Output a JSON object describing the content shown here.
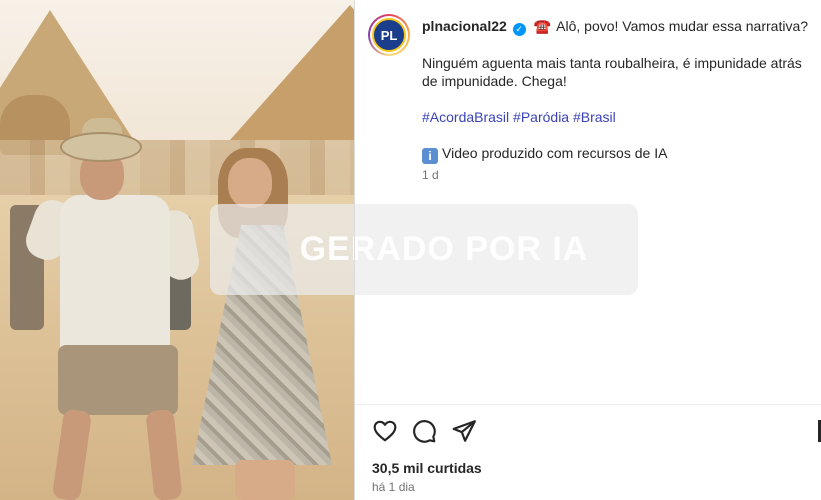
{
  "post": {
    "username": "plnacional22",
    "avatar_text": "PL",
    "headline": "Alô, povo! Vamos mudar essa narrativa?",
    "paragraph": "Ninguém aguenta mais tanta roubalheira, é impunidade atrás de impunidade. Chega!",
    "hashtags": [
      "#AcordaBrasil",
      "#Paródia",
      "#Brasil"
    ],
    "disclaimer": "Video produzido com recursos de IA",
    "timestamp_short": "1 d",
    "likes": "30,5 mil curtidas",
    "date": "há 1 dia"
  },
  "media": {
    "watermark": "GERADO POR IA"
  },
  "icons": {
    "verified": "verified-badge-icon",
    "phone": "telephone-icon",
    "info": "info-icon",
    "like": "heart-icon",
    "comment": "comment-icon",
    "share": "send-icon",
    "save": "bookmark-icon"
  },
  "colors": {
    "hashtag": "#3b43b6",
    "verified": "#0095f6",
    "secondary_text": "#737373",
    "primary_text": "#262626"
  }
}
